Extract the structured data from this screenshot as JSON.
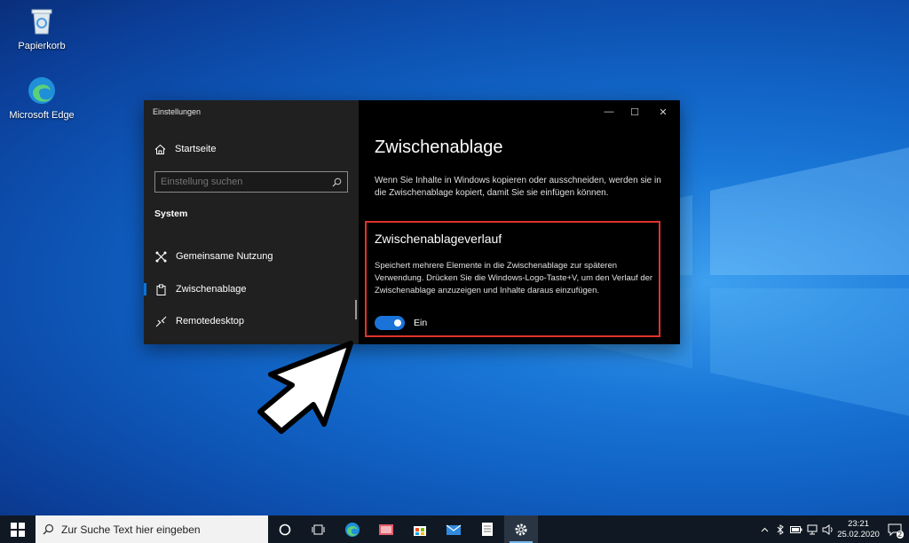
{
  "desktop": {
    "icons": [
      {
        "label": "Papierkorb",
        "icon": "recycle-bin-icon"
      },
      {
        "label": "Microsoft Edge",
        "icon": "edge-icon"
      }
    ]
  },
  "window": {
    "title": "Einstellungen",
    "controls": {
      "minimize": "—",
      "maximize": "☐",
      "close": "✕"
    }
  },
  "sidebar": {
    "home_label": "Startseite",
    "search_placeholder": "Einstellung suchen",
    "section_title": "System",
    "items": [
      {
        "label": "Gemeinsame Nutzung",
        "icon": "shared-experiences-icon"
      },
      {
        "label": "Zwischenablage",
        "icon": "clipboard-icon",
        "active": true
      },
      {
        "label": "Remotedesktop",
        "icon": "remote-desktop-icon"
      }
    ]
  },
  "content": {
    "page_title": "Zwischenablage",
    "page_description": "Wenn Sie Inhalte in Windows kopieren oder ausschneiden, werden sie in die Zwischenablage kopiert, damit Sie sie einfügen können.",
    "history": {
      "title": "Zwischenablageverlauf",
      "description": "Speichert mehrere Elemente in die Zwischenablage zur späteren Verwendung. Drücken Sie die Windows-Logo-Taste+V, um den Verlauf der Zwischenablage anzuzeigen und Inhalte daraus einzufügen.",
      "toggle_on": true,
      "toggle_label": "Ein"
    }
  },
  "taskbar": {
    "search_placeholder": "Zur Suche Text hier eingeben",
    "apps": [
      "cortana-icon",
      "task-view-icon",
      "edge-icon",
      "photos-icon",
      "store-icon",
      "mail-icon",
      "notepad-icon",
      "settings-icon"
    ],
    "clock": {
      "time": "23:21",
      "date": "25.02.2020"
    },
    "notifications_count": "2"
  },
  "colors": {
    "accent": "#1a73d9",
    "highlight_border": "#e0322b"
  }
}
